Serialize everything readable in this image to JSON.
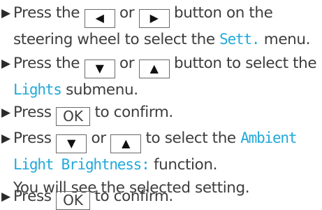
{
  "bullet": "▶",
  "colors": {
    "display_text": "#22a9da",
    "body_text": "#3d3d3d"
  },
  "keys": {
    "left": "◀",
    "right": "▶",
    "down": "▼",
    "up": "▲",
    "ok": "OK"
  },
  "steps": [
    {
      "pre": "Press the ",
      "mid": " or ",
      "post": " button on the",
      "line2_pre": "steering wheel to select the ",
      "menu": "Sett.",
      "line2_post": " menu."
    },
    {
      "pre": "Press the ",
      "mid": " or ",
      "post": " button to select the",
      "submenu": "Lights",
      "line2_post": " submenu."
    },
    {
      "pre": "Press ",
      "post": " to confirm."
    },
    {
      "pre": "Press ",
      "mid": " or ",
      "post": " to select the ",
      "function_a": "Ambient",
      "function_b": "Light Brightness:",
      "line2_post": " function.",
      "line3": "You will see the selected setting."
    },
    {
      "pre": "Press ",
      "post": " to confirm."
    }
  ]
}
